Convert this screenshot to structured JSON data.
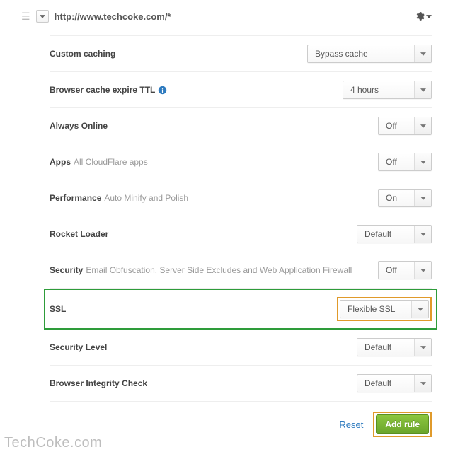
{
  "header": {
    "url": "http://www.techcoke.com/*"
  },
  "rows": {
    "custom_caching": {
      "label": "Custom caching",
      "value": "Bypass cache"
    },
    "browser_ttl": {
      "label": "Browser cache expire TTL",
      "value": "4 hours"
    },
    "always_online": {
      "label": "Always Online",
      "value": "Off"
    },
    "apps": {
      "label": "Apps",
      "sub": "All CloudFlare apps",
      "value": "Off"
    },
    "performance": {
      "label": "Performance",
      "sub": "Auto Minify and Polish",
      "value": "On"
    },
    "rocket_loader": {
      "label": "Rocket Loader",
      "value": "Default"
    },
    "security": {
      "label": "Security",
      "sub": "Email Obfuscation, Server Side Excludes and Web Application Firewall",
      "value": "Off"
    },
    "ssl": {
      "label": "SSL",
      "value": "Flexible SSL"
    },
    "security_level": {
      "label": "Security Level",
      "value": "Default"
    },
    "browser_check": {
      "label": "Browser Integrity Check",
      "value": "Default"
    }
  },
  "footer": {
    "reset": "Reset",
    "add_rule": "Add rule"
  },
  "watermark": "TechCoke.com"
}
